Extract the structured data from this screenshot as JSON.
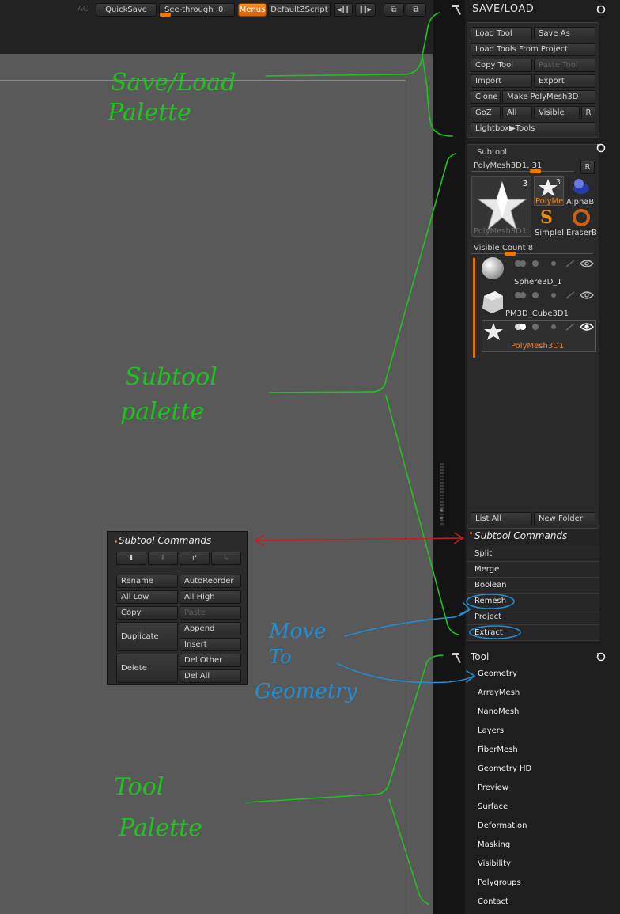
{
  "topbar": {
    "ac": "AC",
    "quicksave": "QuickSave",
    "see_through_label": "See-through",
    "see_through_value": "0",
    "menus": "Menus",
    "default_zscript": "DefaultZScript"
  },
  "save_load": {
    "title": "SAVE/LOAD",
    "load_tool": "Load Tool",
    "save_as": "Save As",
    "load_from_project": "Load Tools From Project",
    "copy_tool": "Copy Tool",
    "paste_tool": "Paste Tool",
    "import": "Import",
    "export": "Export",
    "clone": "Clone",
    "make_polymesh": "Make PolyMesh3D",
    "goz": "GoZ",
    "all": "All",
    "visible": "Visible",
    "r": "R",
    "lightbox_tools": "Lightbox▶Tools"
  },
  "subtool": {
    "title": "Subtool",
    "slider_label": "PolyMesh3D1. 31",
    "r": "R",
    "main_thumb_count": "3",
    "main_thumb_label": "PolyMesh3D1",
    "small_thumbs": [
      {
        "label": "PolyMe",
        "count": "3"
      },
      {
        "label": "AlphaB",
        "count": ""
      },
      {
        "label": "SimpleI",
        "count": ""
      },
      {
        "label": "EraserB",
        "count": ""
      }
    ],
    "visible_count_label": "Visible Count",
    "visible_count_value": "8",
    "items": [
      {
        "name": "Sphere3D_1"
      },
      {
        "name": "PM3D_Cube3D1"
      },
      {
        "name": "PolyMesh3D1"
      }
    ],
    "list_all": "List All",
    "new_folder": "New Folder"
  },
  "subtool_commands": {
    "title": "Subtool Commands",
    "rows": [
      "Split",
      "Merge",
      "Boolean",
      "Remesh",
      "Project",
      "Extract"
    ]
  },
  "floating_commands": {
    "title": "Subtool Commands",
    "rename": "Rename",
    "auto_reorder": "AutoReorder",
    "all_low": "All Low",
    "all_high": "All High",
    "copy": "Copy",
    "paste": "Paste",
    "duplicate": "Duplicate",
    "append": "Append",
    "insert": "Insert",
    "delete": "Delete",
    "del_other": "Del Other",
    "del_all": "Del All"
  },
  "tool": {
    "title": "Tool",
    "items": [
      "Geometry",
      "ArrayMesh",
      "NanoMesh",
      "Layers",
      "FiberMesh",
      "Geometry HD",
      "Preview",
      "Surface",
      "Deformation",
      "Masking",
      "Visibility",
      "Polygroups",
      "Contact"
    ]
  },
  "annotations": {
    "save_load": [
      "Save/Load",
      "Palette"
    ],
    "subtool": [
      "Subtool",
      "palette"
    ],
    "move": [
      "Move",
      "To",
      "Geometry"
    ],
    "tool": [
      "Tool",
      "Palette"
    ]
  },
  "colors": {
    "accent": "#f07800",
    "annotation_green": "#1fc21f",
    "annotation_blue": "#1f8fd6",
    "annotation_red": "#c21f1f"
  }
}
